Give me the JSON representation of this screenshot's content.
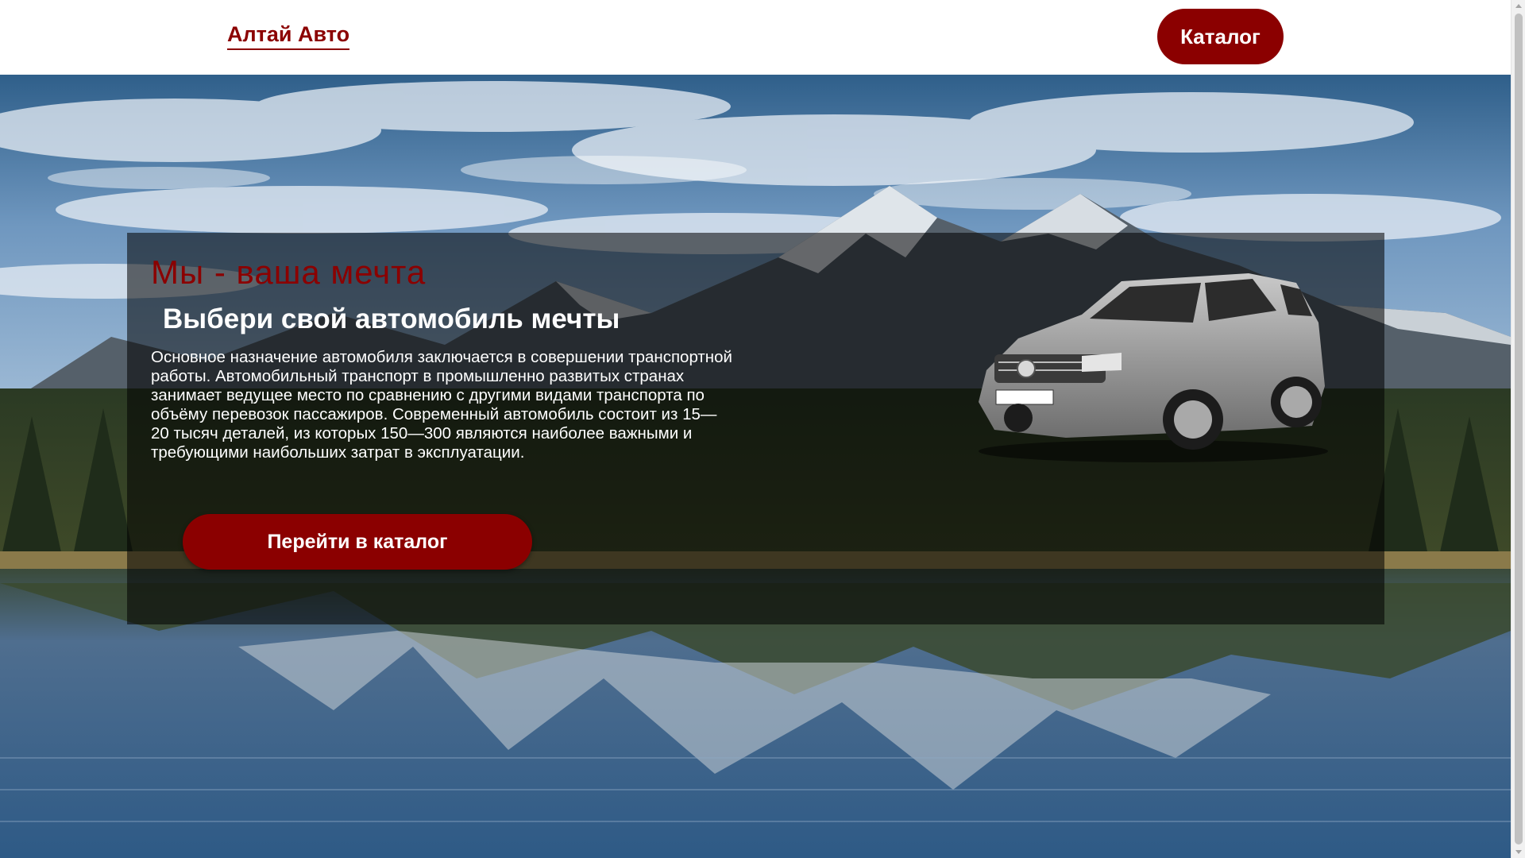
{
  "header": {
    "logo": "Алтай Авто",
    "catalog_button": "Каталог"
  },
  "hero": {
    "tagline": "Мы - ваша мечта",
    "headline": "Выбери свой автомобиль мечты",
    "description": "Основное назначение автомобиля заключается в совершении транспортной работы. Автомобильный транспорт в промышленно развитых странах занимает ведущее место по сравнению с другими видами транспорта по объёму перевозок пассажиров. Современный автомобиль состоит из 15—20 тысяч деталей, из которых 150—300 являются наиболее важными и требующими наибольших затрат в эксплуатации.",
    "cta_button": "Перейти в каталог"
  },
  "colors": {
    "brand": "#8b0000",
    "header_bg": "#ffffff",
    "panel_overlay": "rgba(0,0,0,0.55)"
  },
  "images": {
    "background": "mountain-lake-landscape",
    "car": "silver-suv"
  }
}
